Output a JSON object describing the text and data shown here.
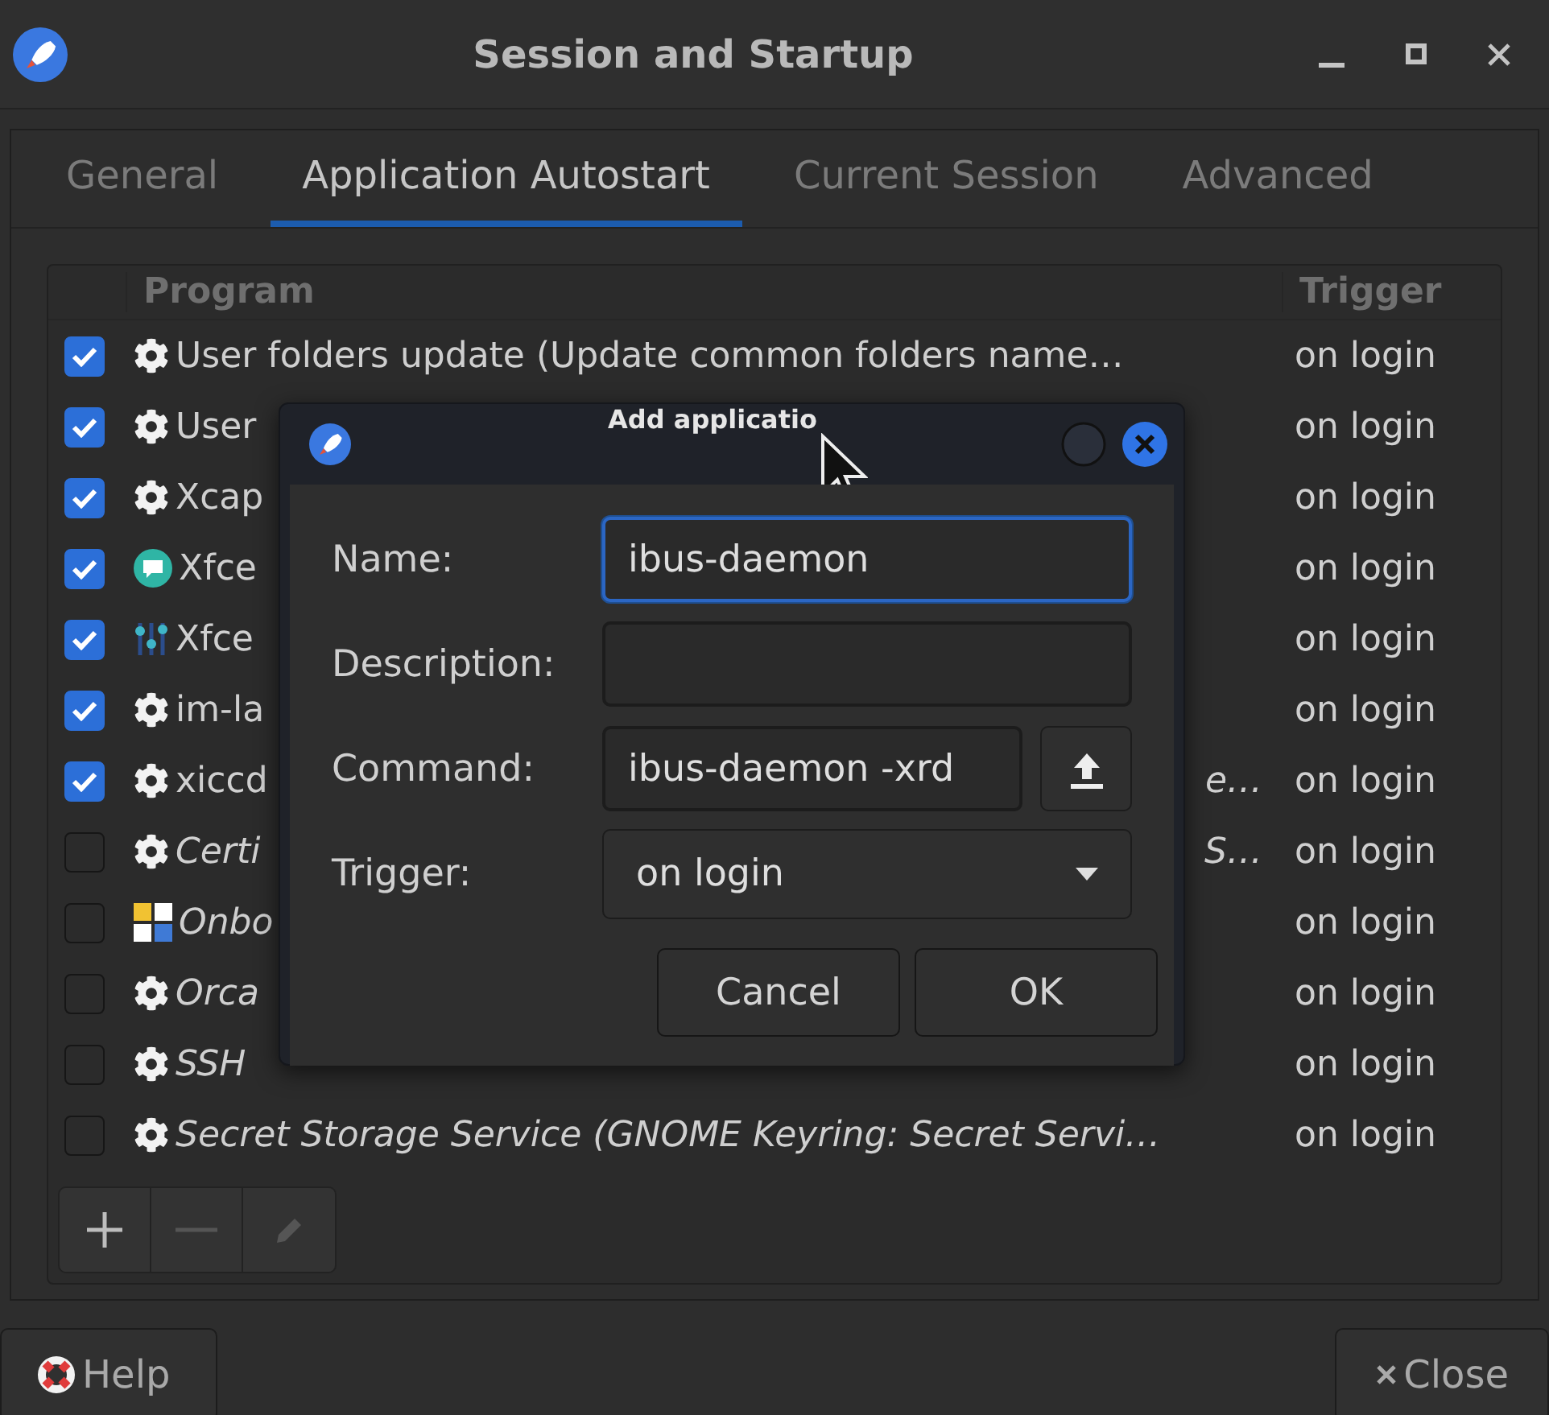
{
  "window": {
    "title": "Session and Startup"
  },
  "tabs": [
    {
      "label": "General",
      "selected": false
    },
    {
      "label": "Application Autostart",
      "selected": true
    },
    {
      "label": "Current Session",
      "selected": false
    },
    {
      "label": "Advanced",
      "selected": false
    }
  ],
  "table": {
    "columns": [
      "Program",
      "Trigger"
    ],
    "rows": [
      {
        "checked": true,
        "kind": "gear",
        "program": "User folders update (Update common folders name…",
        "trigger": "on login"
      },
      {
        "checked": true,
        "kind": "gear",
        "program": "User",
        "trigger": "on login"
      },
      {
        "checked": true,
        "kind": "gear",
        "program": "Xcap",
        "trigger": "on login"
      },
      {
        "checked": true,
        "kind": "chat",
        "program": "Xfce",
        "trigger": "on login"
      },
      {
        "checked": true,
        "kind": "mixer",
        "program": "Xfce",
        "trigger": "on login"
      },
      {
        "checked": true,
        "kind": "gear",
        "program": "im-la",
        "trigger": "on login"
      },
      {
        "checked": true,
        "kind": "gear",
        "program": "xiccd",
        "program_tail": "e…",
        "trigger": "on login"
      },
      {
        "checked": false,
        "kind": "gear",
        "program": "Certi",
        "program_tail": "S…",
        "trigger": "on login"
      },
      {
        "checked": false,
        "kind": "grid",
        "program": "Onbo",
        "trigger": "on login"
      },
      {
        "checked": false,
        "kind": "gear",
        "program": "Orca",
        "trigger": "on login"
      },
      {
        "checked": false,
        "kind": "gear",
        "program": "SSH",
        "trigger": "on login"
      },
      {
        "checked": false,
        "kind": "gear",
        "program": "Secret Storage Service (GNOME Keyring: Secret Servi…",
        "trigger": "on login"
      }
    ]
  },
  "toolbar": [
    {
      "kind": "add",
      "disabled": false
    },
    {
      "kind": "remove",
      "disabled": true
    },
    {
      "kind": "edit",
      "disabled": true
    }
  ],
  "dialog": {
    "title": "Add applicatio",
    "fields": [
      {
        "kind": "text",
        "label": "Name:",
        "value": "ibus-daemon",
        "focused": true
      },
      {
        "kind": "text",
        "label": "Description:",
        "focused": false
      },
      {
        "kind": "browse",
        "label": "Command:",
        "value": "ibus-daemon -xrd",
        "focused": false
      },
      {
        "kind": "select",
        "label": "Trigger:",
        "value": "on login"
      }
    ],
    "buttons": [
      "Cancel",
      "OK"
    ]
  },
  "buttons": [
    {
      "kind": "help",
      "label": "Help"
    },
    {
      "kind": "close",
      "label": "Close"
    }
  ]
}
